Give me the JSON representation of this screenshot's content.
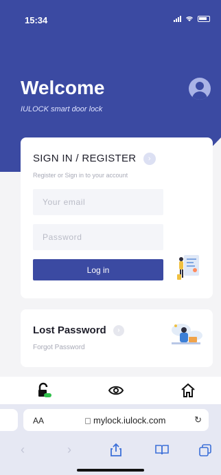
{
  "status_bar": {
    "time": "15:34"
  },
  "header": {
    "title": "Welcome",
    "subtitle": "IULOCK smart door lock"
  },
  "signin": {
    "title": "SIGN IN / REGISTER",
    "subtitle": "Register or Sign in to your account",
    "email_placeholder": "Your email",
    "password_placeholder": "Password",
    "login_label": "Log in"
  },
  "lost_password": {
    "title": "Lost Password",
    "subtitle": "Forgot Password"
  },
  "tabbar": {
    "items": [
      {
        "icon": "unlock-icon"
      },
      {
        "icon": "eye-icon"
      },
      {
        "icon": "home-icon"
      }
    ]
  },
  "browser": {
    "text_size_label": "AA",
    "url": "mylock.iulock.com"
  },
  "colors": {
    "brand": "#3b4aa2",
    "accent_green": "#2fbf4a"
  }
}
